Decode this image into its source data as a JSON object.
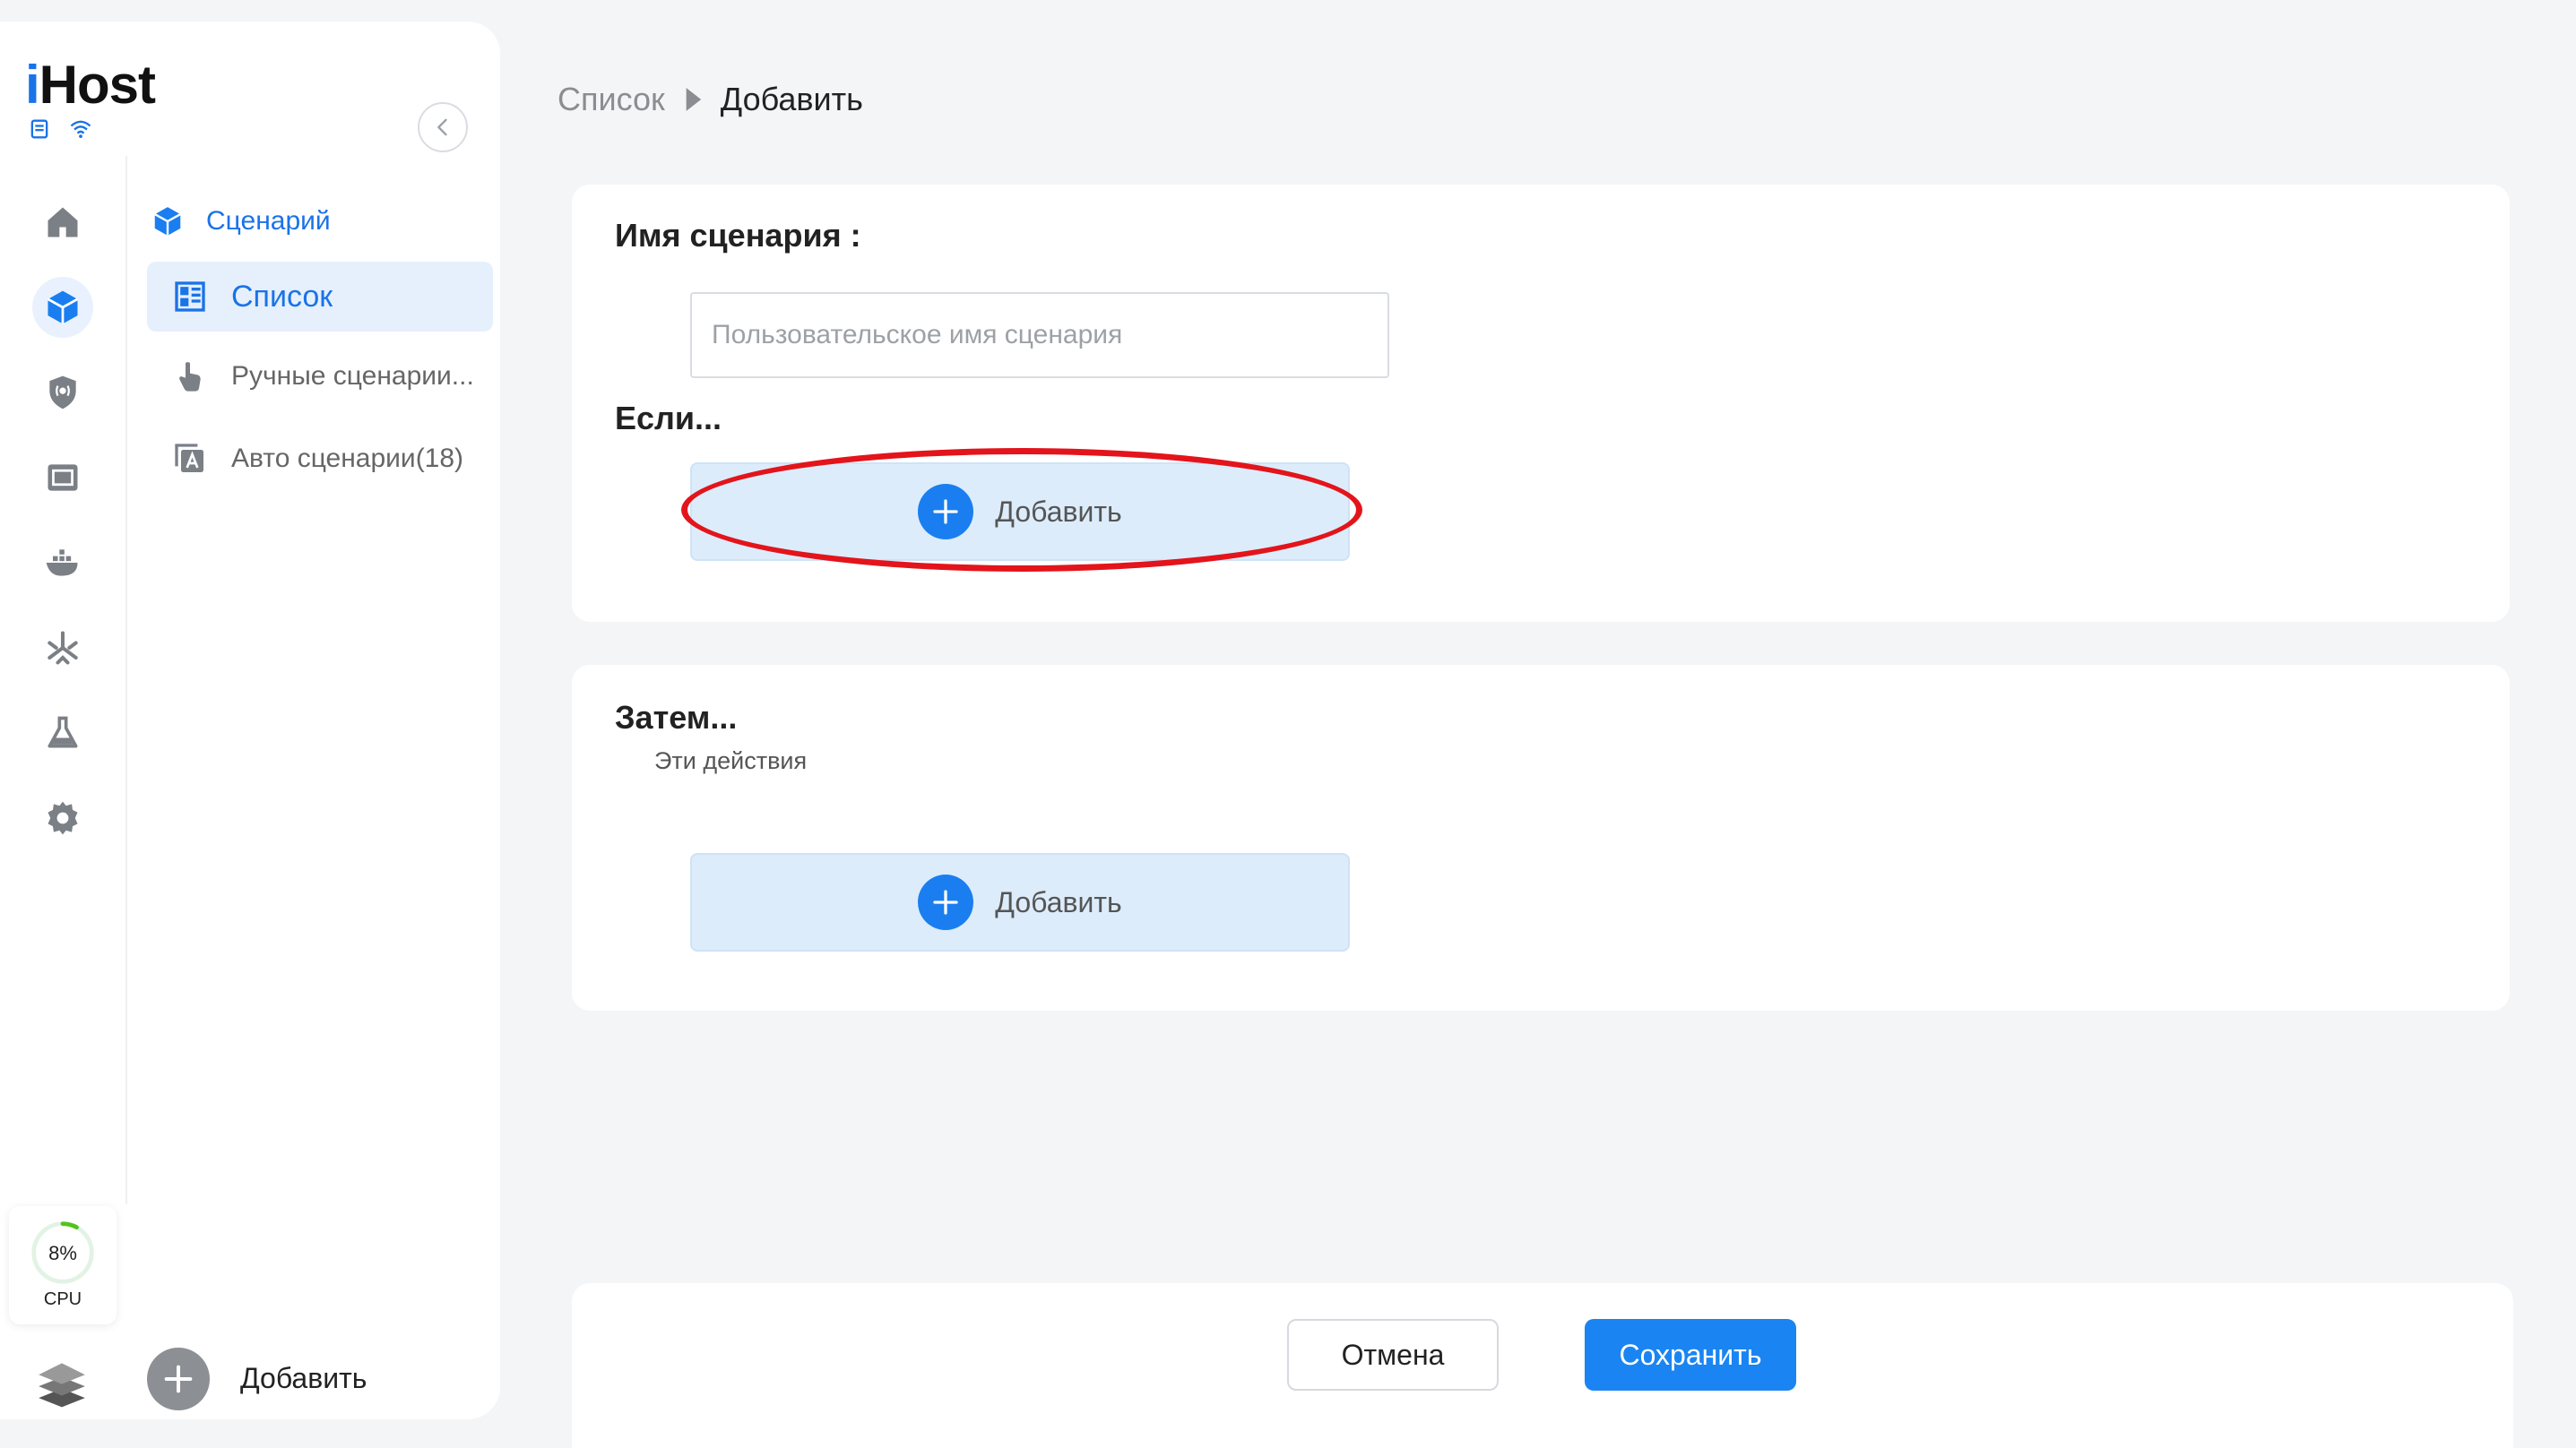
{
  "app": {
    "logo_prefix": "i",
    "logo_suffix": "Host",
    "cpu_value": "8%",
    "cpu_label": "CPU",
    "cpu_percent": 8
  },
  "sidebar": {
    "menu_group": "Сценарий",
    "items": [
      {
        "label": "Список",
        "icon": "grid-list-icon"
      },
      {
        "label": "Ручные сценарии...",
        "icon": "hand-pointer-icon"
      },
      {
        "label": "Авто сценарии(18)",
        "icon": "auto-icon"
      }
    ],
    "add_label": "Добавить"
  },
  "breadcrumb": {
    "parent": "Список",
    "current": "Добавить"
  },
  "form": {
    "name_title": "Имя сценария :",
    "name_placeholder": "Пользовательское имя сценария",
    "if_title": "Если...",
    "if_add_label": "Добавить",
    "then_title": "Затем...",
    "then_subtitle": "Эти действия",
    "then_add_label": "Добавить"
  },
  "footer": {
    "cancel_label": "Отмена",
    "save_label": "Сохранить"
  },
  "colors": {
    "accent": "#1a85f2",
    "highlight": "#e3141b",
    "add_block_bg": "#dcecfb"
  }
}
